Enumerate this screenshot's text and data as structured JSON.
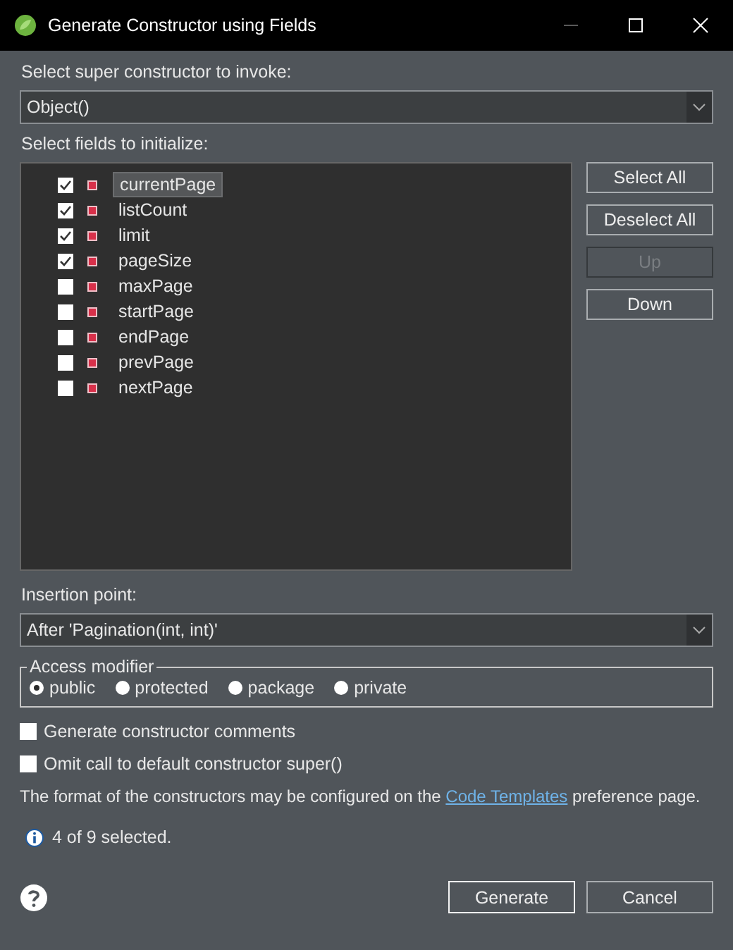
{
  "window": {
    "title": "Generate Constructor using Fields"
  },
  "super_constructor": {
    "label": "Select super constructor to invoke:",
    "value": "Object()"
  },
  "fields": {
    "label": "Select fields to initialize:",
    "items": [
      {
        "name": "currentPage",
        "checked": true,
        "selected": true
      },
      {
        "name": "listCount",
        "checked": true,
        "selected": false
      },
      {
        "name": "limit",
        "checked": true,
        "selected": false
      },
      {
        "name": "pageSize",
        "checked": true,
        "selected": false
      },
      {
        "name": "maxPage",
        "checked": false,
        "selected": false
      },
      {
        "name": "startPage",
        "checked": false,
        "selected": false
      },
      {
        "name": "endPage",
        "checked": false,
        "selected": false
      },
      {
        "name": "prevPage",
        "checked": false,
        "selected": false
      },
      {
        "name": "nextPage",
        "checked": false,
        "selected": false
      }
    ]
  },
  "side_buttons": [
    {
      "label": "Select All",
      "disabled": false
    },
    {
      "label": "Deselect All",
      "disabled": false
    },
    {
      "label": "Up",
      "disabled": true
    },
    {
      "label": "Down",
      "disabled": false
    }
  ],
  "insertion_point": {
    "label": "Insertion point:",
    "value": "After 'Pagination(int, int)'"
  },
  "access_modifier": {
    "label": "Access modifier",
    "options": [
      {
        "label": "public",
        "selected": true
      },
      {
        "label": "protected",
        "selected": false
      },
      {
        "label": "package",
        "selected": false
      },
      {
        "label": "private",
        "selected": false
      }
    ]
  },
  "options": [
    {
      "label": "Generate constructor comments",
      "checked": false
    },
    {
      "label": "Omit call to default constructor super()",
      "checked": false
    }
  ],
  "info": {
    "before": "The format of the constructors may be configured on the",
    "link": "Code Templates",
    "after": "preference page."
  },
  "status": "4 of 9 selected.",
  "buttons": [
    {
      "label": "Generate",
      "default": true
    },
    {
      "label": "Cancel",
      "default": false
    }
  ]
}
